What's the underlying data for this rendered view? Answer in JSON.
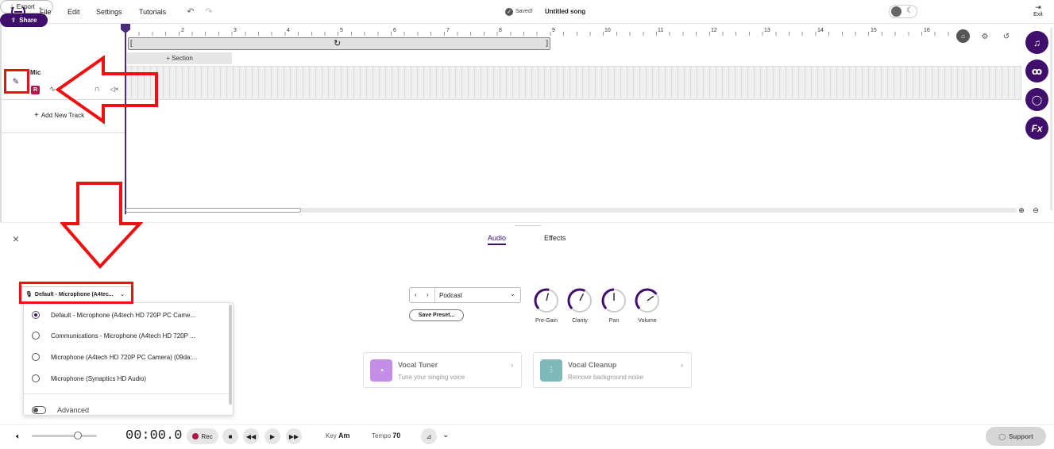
{
  "menu": {
    "file": "File",
    "edit": "Edit",
    "settings": "Settings",
    "tutorials": "Tutorials"
  },
  "status": {
    "saved": "Saved!",
    "song_title": "Untitled song"
  },
  "header": {
    "export_label": "Export",
    "share_label": "Share",
    "exit_label": "Exit"
  },
  "ruler": {
    "bars": [
      "2",
      "3",
      "4",
      "5",
      "6",
      "7",
      "8",
      "9",
      "10",
      "11",
      "12",
      "13",
      "14",
      "15",
      "16"
    ]
  },
  "section_label": "+ Section",
  "track": {
    "name": "Mic",
    "record_badge": "R",
    "add_track": "Add New Track"
  },
  "panel": {
    "tab_audio": "Audio",
    "tab_effects": "Effects"
  },
  "input": {
    "selected": "Default - Microphone (A4tec...",
    "options": [
      {
        "label": "Default - Microphone (A4tech HD 720P PC Came...",
        "selected": true
      },
      {
        "label": "Communications - Microphone (A4tech HD 720P ...",
        "selected": false
      },
      {
        "label": "Microphone (A4tech HD 720P PC Camera) (09da:...",
        "selected": false
      },
      {
        "label": "Microphone (Synaptics HD Audio)",
        "selected": false
      }
    ],
    "advanced_label": "Advanced"
  },
  "preset": {
    "name": "Podcast",
    "save_label": "Save Preset..."
  },
  "knobs": [
    {
      "label": "Pre-Gain",
      "level": 0.55
    },
    {
      "label": "Clarity",
      "level": 0.6
    },
    {
      "label": "Pan",
      "level": 0.5
    },
    {
      "label": "Volume",
      "level": 0.7
    }
  ],
  "cards": [
    {
      "title": "Vocal Tuner",
      "subtitle": "Tune your singing voice",
      "color": "#c58ee6"
    },
    {
      "title": "Vocal Cleanup",
      "subtitle": "Remove background noise",
      "color": "#7fb9b9"
    }
  ],
  "transport": {
    "time": "00:00.0",
    "rec_label": "Rec",
    "key_label": "Key",
    "key_value": "Am",
    "tempo_label": "Tempo",
    "tempo_value": "70",
    "support_label": "Support"
  },
  "colors": {
    "brand": "#3f0f6b",
    "annotation": "#e11111"
  }
}
